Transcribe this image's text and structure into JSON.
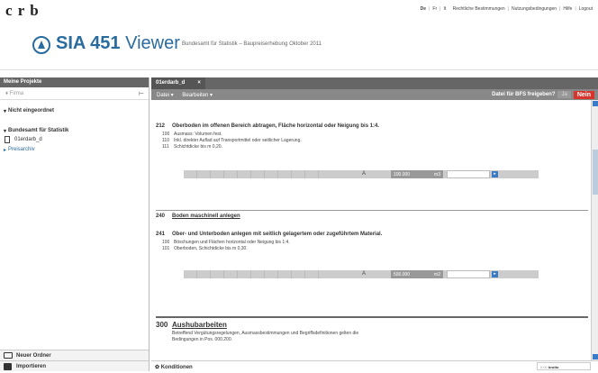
{
  "brand": {
    "crb": "c r b"
  },
  "top_links": [
    "De",
    "Fr",
    "It",
    "Rechtliche Bestimmungen",
    "Nutzungsbedingungen",
    "Hilfe",
    "Logout"
  ],
  "header": {
    "app_name_bold": "SIA 451",
    "app_name_rest": " Viewer",
    "subtitle": "Bundesamt für Statistik – Baupreiserhebung Oktober 2011"
  },
  "sidebar": {
    "heading": "Meine Projekte",
    "search_placeholder": "Firma",
    "items": [
      {
        "label": "Nicht eingeordnet"
      },
      {
        "label": "Bundesamt für Statistik"
      }
    ],
    "file": "01erdarb_d",
    "archive": "Preisarchiv",
    "new_folder": "Neuer Ordner",
    "import": "Importieren"
  },
  "tab": {
    "label": "01erdarb_d",
    "close": "×"
  },
  "menu": {
    "file": "Datei ▾",
    "edit": "Bearbeiten ▾",
    "ifs_question": "Datei für BFS freigeben?",
    "ja": "Ja",
    "nein": "Nein"
  },
  "content": {
    "r212": {
      "num": "212",
      "title": "Oberboden im offenen Bereich abtragen, Fläche horizontal oder Neigung bis 1:4.",
      "subs": [
        {
          "n": "100",
          "t": "Ausmass: Volumen fest."
        },
        {
          "n": "110",
          "t": "Inkl. direkter Auflad auf Transportmittel oder seitlicher Lagerung."
        },
        {
          "n": "111",
          "t": "Schichtdicke bis m 0,20."
        }
      ],
      "letter": "A",
      "qty": "100.000",
      "unit": "m3",
      "go": "▸"
    },
    "r240": {
      "num": "240",
      "title": "Boden maschinell anlegen"
    },
    "r241": {
      "num": "241",
      "title": "Ober- und Unterboden anlegen mit seitlich gelagertem oder zugeführtem Material.",
      "subs": [
        {
          "n": "100",
          "t": "Böschungen und Flächen horizontal oder Neigung bis 1:4."
        },
        {
          "n": "101",
          "t": "Oberboden, Schichtdicke bis m 0,30."
        }
      ],
      "letter": "A",
      "qty": "500.000",
      "unit": "m2",
      "go": "▸"
    },
    "r300": {
      "num": "300",
      "title": "Aushubarbeiten",
      "lines": [
        "Betreffend Vergütungsregelungen, Ausmassbestimmungen und Begriffsdefinitionen gelten die",
        "Bedingungen in Pos. 000.200."
      ]
    }
  },
  "footer": {
    "konditionen": "Konditionen",
    "total_label": "0.00",
    "total_unit": "brutto"
  }
}
